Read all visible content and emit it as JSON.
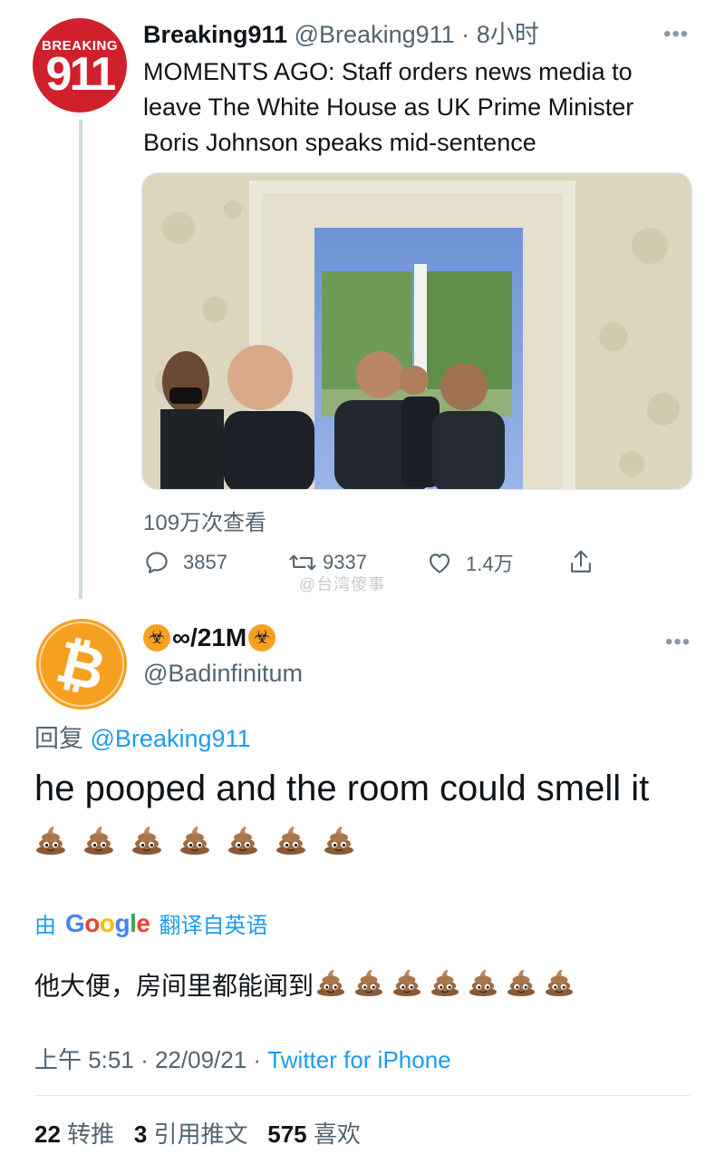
{
  "parent_tweet": {
    "avatar_label_top": "BREAKING",
    "avatar_label_number": "911",
    "display_name": "Breaking911",
    "handle": "@Breaking911",
    "separator": "·",
    "time": "8小时",
    "more": "•••",
    "text_line1": "MOMENTS AGO: Staff orders news media to",
    "text_line2": "leave The White House as UK Prime Minister",
    "text_line3": "Boris Johnson speaks mid-sentence",
    "views": "109万次查看",
    "replies": "3857",
    "retweets": "9337",
    "likes": "1.4万",
    "watermark": "@台湾傻事"
  },
  "reply_tweet": {
    "avatar_glyph": "₿",
    "display_name": "∞/21M",
    "name_icon": "☣",
    "handle": "@Badinfinitum",
    "more": "•••",
    "reply_prefix": "回复",
    "reply_mention": "@Breaking911",
    "text": "he pooped and the room could smell it",
    "poop_emoji_count": 7,
    "translate_prefix": "由",
    "translate_brand": "Google",
    "translate_suffix": "翻译自英语",
    "translated_text": "他大便，房间里都能闻到",
    "meta_time": "上午 5:51",
    "meta_sep": "·",
    "meta_date": "22/09/21",
    "meta_source": "Twitter for iPhone",
    "retweet_count": "22",
    "retweet_label": "转推",
    "quote_count": "3",
    "quote_label": "引用推文",
    "like_count": "575",
    "like_label": "喜欢"
  },
  "colors": {
    "link": "#1d9bf0",
    "secondary": "#536471",
    "brand_red": "#d0202c",
    "bitcoin_orange": "#f6a021"
  }
}
